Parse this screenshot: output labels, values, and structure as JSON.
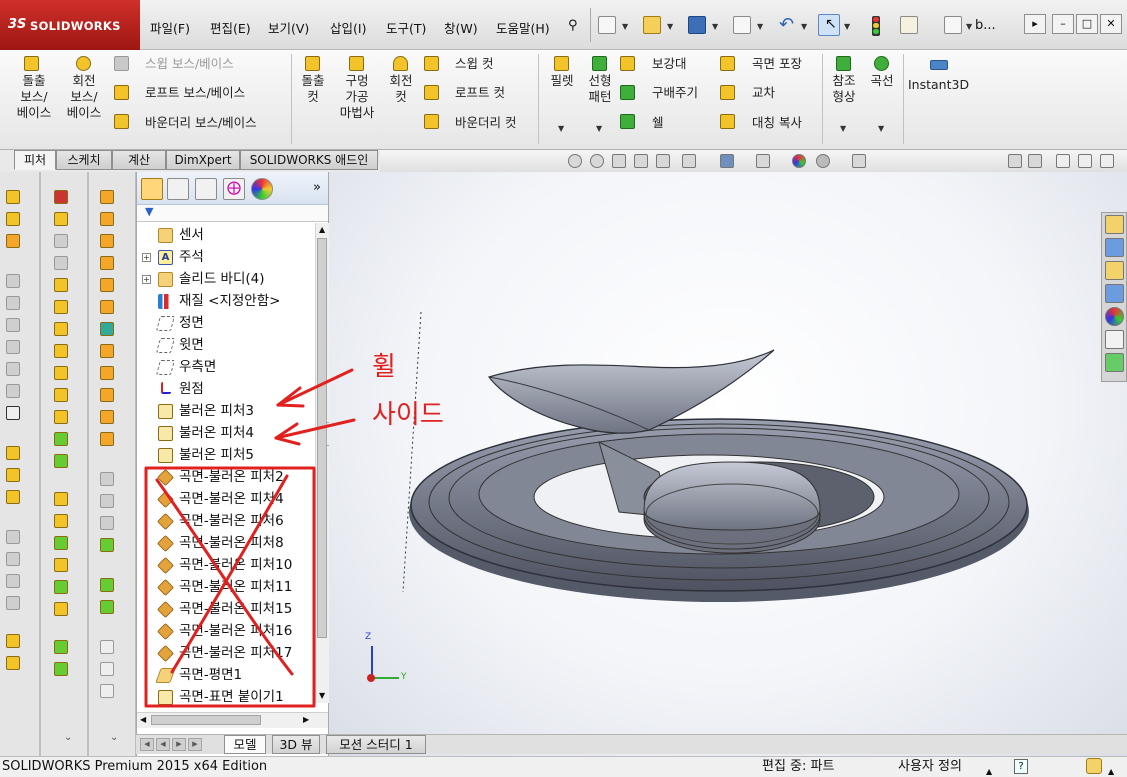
{
  "app": {
    "brand_mark": "3S",
    "brand": "SOLIDWORKS",
    "doc_title": "b..."
  },
  "menu": [
    "파일(F)",
    "편집(E)",
    "보기(V)",
    "삽입(I)",
    "도구(T)",
    "창(W)",
    "도움말(H)"
  ],
  "ribbon": {
    "extrude_boss": "돌출\n보스/\n베이스",
    "revolve_boss": "회전\n보스/\n베이스",
    "sweep_boss": "스윕 보스/베이스",
    "loft_boss": "로프트 보스/베이스",
    "boundary_boss": "바운더리 보스/베이스",
    "extrude_cut": "돌출\n컷",
    "hole_wizard": "구멍\n가공\n마법사",
    "revolve_cut": "회전\n컷",
    "sweep_cut": "스윕 컷",
    "loft_cut": "로프트 컷",
    "boundary_cut": "바운더리 컷",
    "fillet": "필렛",
    "linear_pattern": "선형\n패턴",
    "rib": "보강대",
    "draft": "구배주기",
    "shell": "쉘",
    "wrap": "곡면 포장",
    "intersect": "교차",
    "mirror": "대칭 복사",
    "ref_geometry": "참조\n형상",
    "curves": "곡선",
    "instant3d": "Instant3D"
  },
  "command_tabs": [
    "피처",
    "스케치",
    "계산",
    "DimXpert",
    "SOLIDWORKS 애드인"
  ],
  "feature_tree": {
    "items": [
      {
        "label": "센서",
        "icon": "sensor-icon",
        "expand": false
      },
      {
        "label": "주석",
        "icon": "annotation-icon",
        "expand": true
      },
      {
        "label": "솔리드 바디(4)",
        "icon": "solid-body-icon",
        "expand": true
      },
      {
        "label": "재질 <지정안함>",
        "icon": "material-icon",
        "expand": false
      },
      {
        "label": "정면",
        "icon": "plane-icon",
        "expand": false
      },
      {
        "label": "윗면",
        "icon": "plane-icon",
        "expand": false
      },
      {
        "label": "우측면",
        "icon": "plane-icon",
        "expand": false
      },
      {
        "label": "원점",
        "icon": "origin-icon",
        "expand": false
      },
      {
        "label": "불러온 피처3",
        "icon": "imported-feature-icon",
        "expand": false
      },
      {
        "label": "불러온 피처4",
        "icon": "imported-feature-icon",
        "expand": false
      },
      {
        "label": "불러온 피처5",
        "icon": "imported-feature-icon",
        "expand": false
      },
      {
        "label": "곡면-불러온 피처2",
        "icon": "surface-import-icon",
        "expand": false
      },
      {
        "label": "곡면-불러온 피처4",
        "icon": "surface-import-icon",
        "expand": false
      },
      {
        "label": "곡면-불러온 피처6",
        "icon": "surface-import-icon",
        "expand": false
      },
      {
        "label": "곡면-불러온 피처8",
        "icon": "surface-import-icon",
        "expand": false
      },
      {
        "label": "곡면-불러온 피처10",
        "icon": "surface-import-icon",
        "expand": false
      },
      {
        "label": "곡면-불러온 피처11",
        "icon": "surface-import-icon",
        "expand": false
      },
      {
        "label": "곡면-불러온 피처15",
        "icon": "surface-import-icon",
        "expand": false
      },
      {
        "label": "곡면-불러온 피처16",
        "icon": "surface-import-icon",
        "expand": false
      },
      {
        "label": "곡면-불러온 피처17",
        "icon": "surface-import-icon",
        "expand": false
      },
      {
        "label": "곡면-평면1",
        "icon": "surface-plane-icon",
        "expand": false
      },
      {
        "label": "곡면-표면 붙이기1",
        "icon": "surface-knit-icon",
        "expand": false
      }
    ]
  },
  "annotations": {
    "line1": "휠",
    "line2": "사이드",
    "color": "#e0211f"
  },
  "triad": {
    "z": "Z",
    "y": "Y"
  },
  "bottom_tabs": [
    "모델",
    "3D 뷰",
    "모션 스터디 1"
  ],
  "status": {
    "left": "SOLIDWORKS Premium 2015 x64 Edition",
    "editing": "편집 중: 파트",
    "custom": "사용자 정의",
    "help": "?"
  },
  "colors": {
    "brand": "#c0261f",
    "selection": "#cfe2f6",
    "feature_icon": "#f3c429"
  }
}
